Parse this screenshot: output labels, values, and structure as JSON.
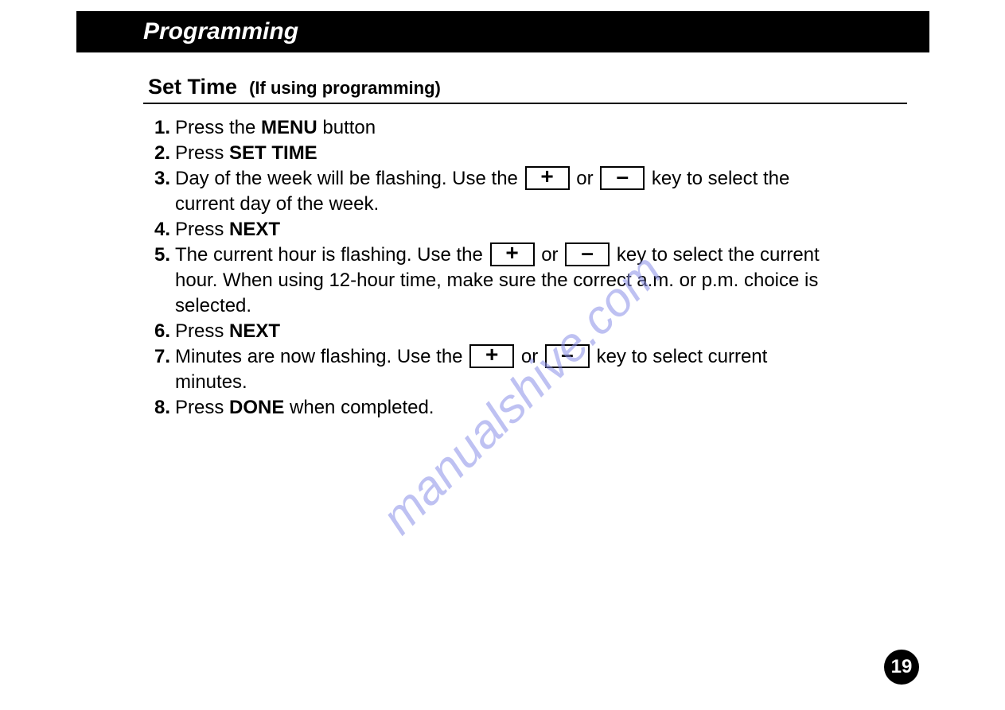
{
  "header": {
    "title": "Programming"
  },
  "section": {
    "title": "Set Time",
    "subtitle": "(If using programming)"
  },
  "keys": {
    "plus": "+",
    "minus": "–",
    "or": "or"
  },
  "steps": {
    "s1": {
      "a": "Press the ",
      "menu": "MENU",
      "b": " button"
    },
    "s2": {
      "a": "Press ",
      "settime": "SET TIME"
    },
    "s3": {
      "a": "Day of the week will be flashing.  Use the ",
      "b": " key to select the current day of the week."
    },
    "s4": {
      "a": "Press ",
      "next": "NEXT"
    },
    "s5": {
      "a": "The current hour is flashing.  Use the ",
      "b": " key to select the current hour.  When using 12-hour time, make sure the correct a.m. or p.m. choice is selected."
    },
    "s6": {
      "a": "Press ",
      "next": "NEXT"
    },
    "s7": {
      "a": "Minutes are now flashing.  Use the  ",
      "b": " key to select current minutes."
    },
    "s8": {
      "a": "Press ",
      "done": "DONE",
      "b": " when completed."
    }
  },
  "page": {
    "number": "19"
  },
  "watermark": {
    "text": "manualshive.com"
  }
}
